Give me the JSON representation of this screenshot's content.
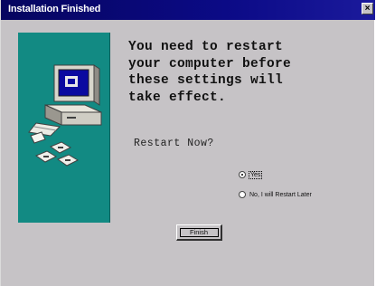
{
  "window": {
    "title": "Installation Finished",
    "close_glyph": "×"
  },
  "message": "You need to restart\nyour computer before\nthese settings will\ntake effect.",
  "question": "Restart Now?",
  "options": [
    {
      "label": "Yes",
      "selected": true
    },
    {
      "label": "No, I will Restart Later",
      "selected": false
    }
  ],
  "finish_label": "Finish",
  "art": {
    "panel_color": "#128a83",
    "icons": [
      "computer-icon",
      "floppy-disk-icon",
      "file-icon"
    ]
  }
}
